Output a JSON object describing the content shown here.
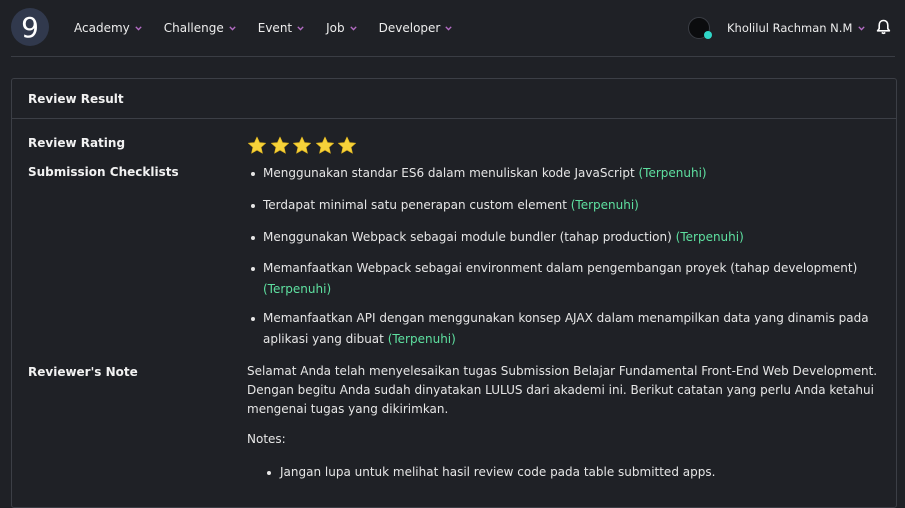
{
  "nav": {
    "logo_text": "9",
    "items": [
      {
        "label": "Academy"
      },
      {
        "label": "Challenge"
      },
      {
        "label": "Event"
      },
      {
        "label": "Job"
      },
      {
        "label": "Developer"
      }
    ],
    "user_name": "Kholilul Rachman N.M"
  },
  "card": {
    "title": "Review Result",
    "rating_label": "Review Rating",
    "rating": 5,
    "rating_max": 5,
    "checklists_label": "Submission Checklists",
    "checklists": [
      {
        "text": "Menggunakan standar ES6 dalam menuliskan kode JavaScript",
        "status": "(Terpenuhi)"
      },
      {
        "text": "Terdapat minimal satu penerapan custom element",
        "status": "(Terpenuhi)"
      },
      {
        "text": "Menggunakan Webpack sebagai module bundler (tahap production)",
        "status": "(Terpenuhi)"
      },
      {
        "text": "Memanfaatkan Webpack sebagai environment dalam pengembangan proyek (tahap development)",
        "status": "(Terpenuhi)"
      },
      {
        "text": "Memanfaatkan API dengan menggunakan konsep AJAX dalam menampilkan data yang dinamis pada aplikasi yang dibuat",
        "status": "(Terpenuhi)"
      }
    ],
    "note_label": "Reviewer's Note",
    "note_text": "Selamat Anda telah menyelesaikan tugas Submission Belajar Fundamental Front-End Web Development. Dengan begitu Anda sudah dinyatakan LULUS dari akademi ini. Berikut catatan yang perlu Anda ketahui mengenai tugas yang dikirimkan.",
    "notes_title": "Notes:",
    "notes": [
      {
        "text": "Jangan lupa untuk melihat hasil review code pada table submitted apps."
      }
    ]
  },
  "colors": {
    "background": "#1f2126",
    "accent_ok": "#5ee0a0",
    "star": "#f6d23a",
    "online_dot": "#2fd6c7"
  }
}
